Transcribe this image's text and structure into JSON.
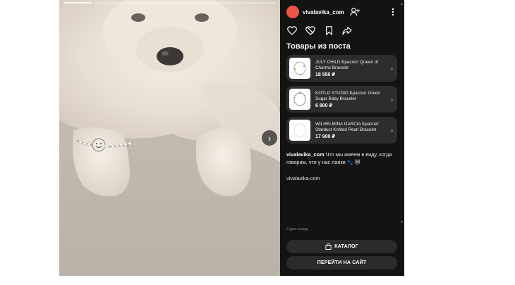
{
  "author": {
    "name": "vivalavika_com",
    "avatar_color": "#e8564a"
  },
  "icons": {
    "follow": "add-user-icon",
    "more": "more-vertical-icon",
    "like": "heart-icon",
    "dislike": "heart-broken-icon",
    "save": "bookmark-icon",
    "share": "share-arrow-icon",
    "next": "chevron-right-icon"
  },
  "products_section": {
    "title": "Товары из поста",
    "items": [
      {
        "name": "JULY CHILD Браслет Queen of Charms Bracelet",
        "price": "18 550 ₽"
      },
      {
        "name": "KOTLO STUDIO Браслет Green Sugar Baby Bracelet",
        "price": "6 800 ₽"
      },
      {
        "name": "WILHELMINA GARCIA Браслет Stardust Knitted Pearl Bracelet",
        "price": "17 900 ₽"
      }
    ]
  },
  "caption": {
    "author": "vivalavika_com",
    "text": "Что мы имеем в виду, когда говорим, что у нас лапки 🐾 😻",
    "link": "vivalavika.com"
  },
  "time_ago": "4 дня назад",
  "buttons": {
    "catalog": "КАТАЛОГ",
    "site": "ПЕРЕЙТИ НА САЙТ"
  },
  "colors": {
    "panel_bg": "#131313",
    "card_bg": "#2d2d2d",
    "button_bg": "#2b2b2b"
  }
}
